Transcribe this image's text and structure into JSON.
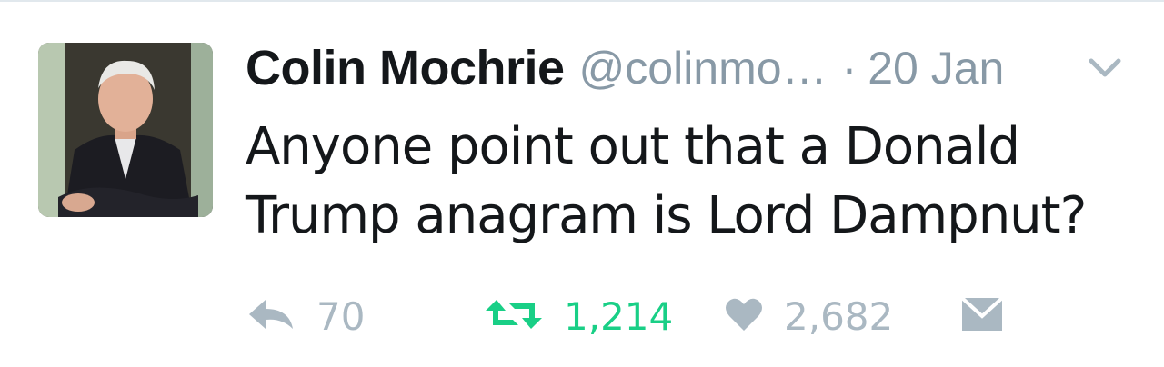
{
  "tweet": {
    "author_name": "Colin Mochrie",
    "handle": "@colinmo…",
    "separator": "·",
    "date": "20 Jan",
    "text_line1": "Anyone point out that a Donald",
    "text_line2": "Trump anagram is Lord Dampnut?"
  },
  "actions": {
    "reply_count": "70",
    "retweet_count": "1,214",
    "like_count": "2,682"
  },
  "icons": {
    "reply": "reply-icon",
    "retweet": "retweet-icon",
    "like": "heart-icon",
    "dm": "envelope-icon",
    "more": "chevron-down-icon"
  },
  "colors": {
    "text": "#14171a",
    "muted": "#8899a6",
    "icon_gray": "#aab8c2",
    "retweet_green": "#19cf86"
  }
}
